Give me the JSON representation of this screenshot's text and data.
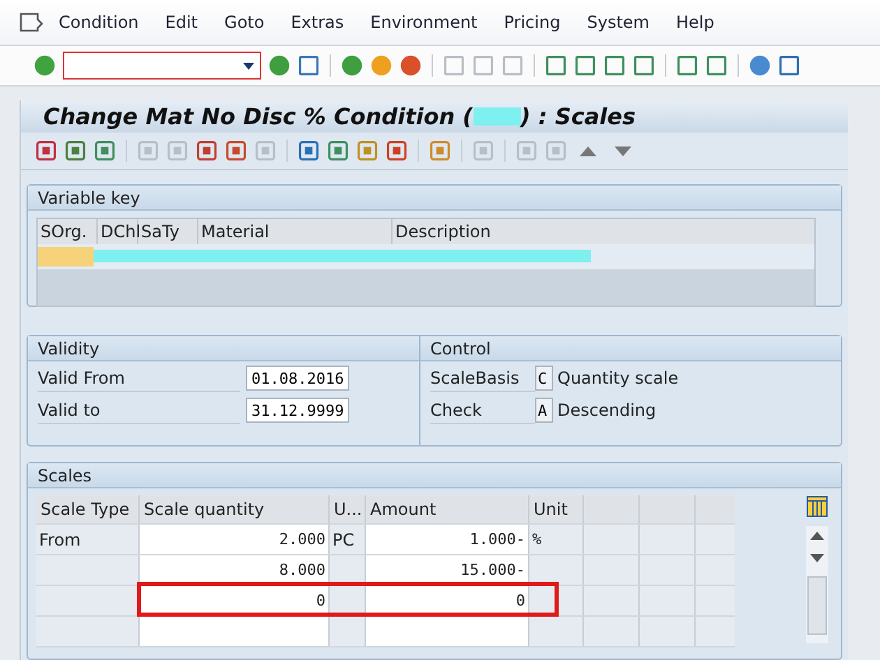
{
  "menu_bar": {
    "items": [
      "Condition",
      "Edit",
      "Goto",
      "Extras",
      "Environment",
      "Pricing",
      "System",
      "Help"
    ]
  },
  "screen_title": {
    "before": "Change Mat No Disc % Condition (",
    "after": ") : Scales"
  },
  "variable_key": {
    "title": "Variable key",
    "columns": [
      "SOrg.",
      "DChl",
      "SaTy",
      "Material",
      "Description"
    ]
  },
  "validity": {
    "title": "Validity",
    "fields": [
      {
        "label": "Valid From",
        "value": "01.08.2016"
      },
      {
        "label": "Valid to",
        "value": "31.12.9999"
      }
    ]
  },
  "control": {
    "title": "Control",
    "fields": [
      {
        "label": "ScaleBasis",
        "code": "C",
        "text": "Quantity scale"
      },
      {
        "label": "Check",
        "code": "A",
        "text": "Descending"
      }
    ]
  },
  "scales": {
    "title": "Scales",
    "columns": [
      "Scale Type",
      "Scale quantity",
      "U...",
      "Amount",
      "Unit"
    ],
    "rows": [
      {
        "scale_type": "From",
        "quantity": "2.000",
        "uom": "PC",
        "amount": "1.000-",
        "unit": "%",
        "highlighted": false
      },
      {
        "quantity": "8.000",
        "amount": "15.000-",
        "highlighted": false
      },
      {
        "quantity": "0",
        "amount": "0",
        "highlighted": true
      },
      {
        "highlighted": false
      }
    ]
  }
}
